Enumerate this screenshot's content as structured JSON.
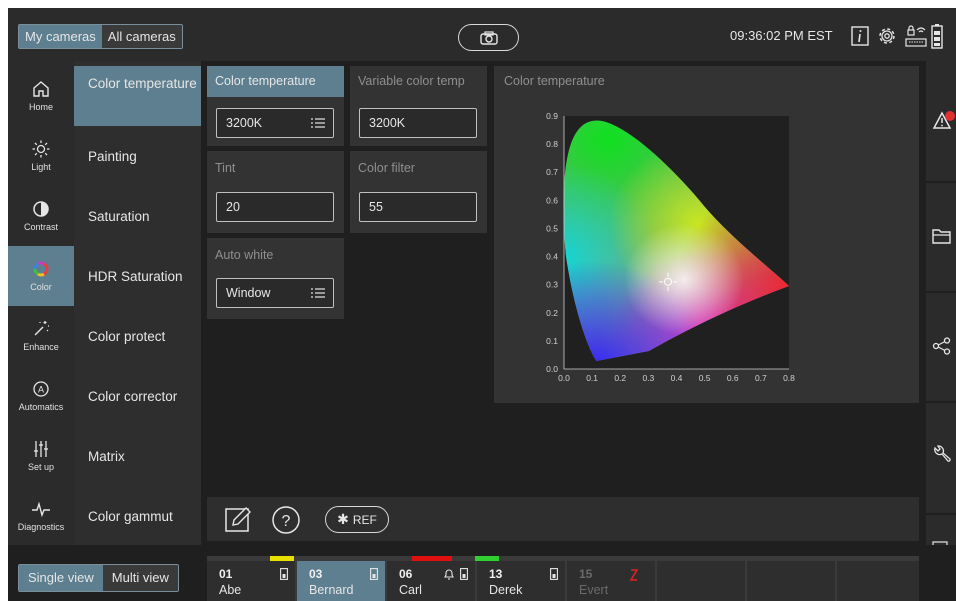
{
  "topbar": {
    "camera_tabs": [
      "My cameras",
      "All cameras"
    ],
    "active_camera_tab": "My cameras",
    "clock": "09:36:02 PM EST",
    "icons": [
      "camera-snapshot-icon",
      "info-icon",
      "settings-gear-icon",
      "network-status-icon",
      "battery-icon"
    ]
  },
  "leftnav": {
    "items": [
      {
        "label": "Home",
        "icon": "home-icon"
      },
      {
        "label": "Light",
        "icon": "sun-icon"
      },
      {
        "label": "Contrast",
        "icon": "contrast-icon"
      },
      {
        "label": "Color",
        "icon": "color-wheel-icon",
        "active": true
      },
      {
        "label": "Enhance",
        "icon": "magic-wand-icon"
      },
      {
        "label": "Automatics",
        "icon": "auto-icon"
      },
      {
        "label": "Set up",
        "icon": "sliders-icon"
      },
      {
        "label": "Diagnostics",
        "icon": "pulse-icon"
      }
    ]
  },
  "submenu": {
    "items": [
      "Color temperature",
      "Painting",
      "Saturation",
      "HDR Saturation",
      "Color protect",
      "Color corrector",
      "Matrix",
      "Color gammut"
    ],
    "active": "Color temperature"
  },
  "params": {
    "color_temperature": {
      "title": "Color temperature",
      "value": "3200K"
    },
    "variable_color_temp": {
      "title": "Variable color temp",
      "value": "3200K"
    },
    "tint": {
      "title": "Tint",
      "value": "20"
    },
    "color_filter": {
      "title": "Color filter",
      "value": "55"
    },
    "auto_white": {
      "title": "Auto white",
      "value": "Window"
    }
  },
  "chart_data": {
    "type": "scatter",
    "title": "Color temperature",
    "xlim": [
      0.0,
      0.8
    ],
    "ylim": [
      0.0,
      0.9
    ],
    "x_ticks": [
      "0.0",
      "0.1",
      "0.2",
      "0.3",
      "0.4",
      "0.5",
      "0.6",
      "0.7",
      "0.8"
    ],
    "y_ticks": [
      "0.0",
      "0.1",
      "0.2",
      "0.3",
      "0.4",
      "0.5",
      "0.6",
      "0.7",
      "0.8",
      "0.9"
    ],
    "white_point": {
      "x": 0.37,
      "y": 0.31
    },
    "grid": false
  },
  "toolbar": {
    "ref_label": "REF",
    "icons": [
      "edit-icon",
      "help-icon",
      "ref-icon"
    ]
  },
  "rightrail": {
    "icons": [
      "alert-icon",
      "folder-icon",
      "share-icon",
      "wrench-icon",
      "device-icon"
    ],
    "alert_color": "#e03030"
  },
  "bottombar": {
    "view_tabs": [
      "Single view",
      "Multi view"
    ],
    "active_view_tab": "Single view",
    "cameras": [
      {
        "num": "01",
        "name": "Abe",
        "tally": "#e8e000",
        "selected": false,
        "dim": false
      },
      {
        "num": "03",
        "name": "Bernard",
        "tally": "",
        "selected": true,
        "dim": false
      },
      {
        "num": "06",
        "name": "Carl",
        "tally": "#e01010",
        "selected": false,
        "dim": false
      },
      {
        "num": "13",
        "name": "Derek",
        "tally": "#30d030",
        "selected": false,
        "dim": false
      },
      {
        "num": "15",
        "name": "Evert",
        "tally": "",
        "selected": false,
        "dim": true
      }
    ]
  },
  "colors": {
    "accent": "#5e7f8f",
    "background": "#1f1f1f",
    "panel": "#333333"
  }
}
